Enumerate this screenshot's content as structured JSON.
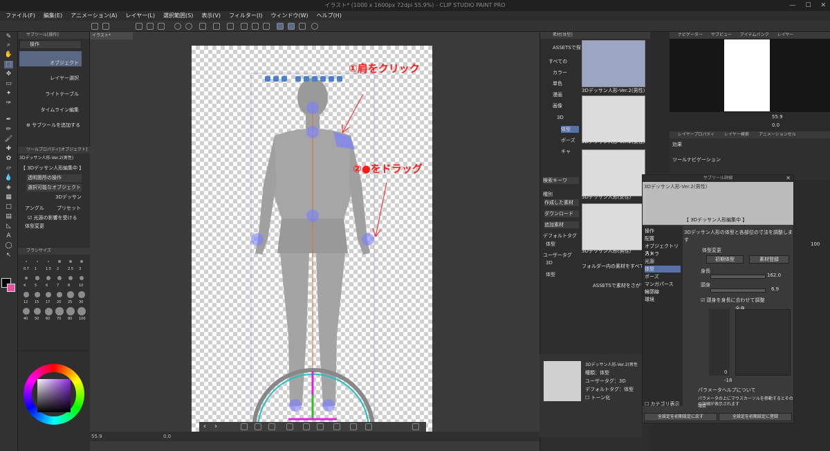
{
  "titlebar": {
    "title": "イラスト* (1000 x 1600px 72dpi 55.9%) - CLIP STUDIO PAINT PRO",
    "controls": [
      "—",
      "☐",
      "✕"
    ]
  },
  "menu": [
    "ファイル(F)",
    "編集(E)",
    "アニメーション(A)",
    "レイヤー(L)",
    "選択範囲(S)",
    "表示(V)",
    "フィルター(I)",
    "ウィンドウ(W)",
    "ヘルプ(H)"
  ],
  "subtool": {
    "header": "サブツール[操作]",
    "tab": "操作",
    "items": [
      "オブジェクト",
      "レイヤー選択",
      "ライトテーブル",
      "タイムライン編集"
    ],
    "add_label": "サブツールを追加する"
  },
  "toolprop": {
    "header": "ツールプロパティ[オブジェクト]",
    "top": "3Dデッサン人形-Ver.2(男性)",
    "mode": "【 3Dデッサン人形編集中 】",
    "rows": [
      "透明箇所の操作",
      "選択可能なオブジェクト",
      "3Dデッサン",
      "アングル",
      "プリセット",
      "光源の影響を受ける",
      "体型変更"
    ]
  },
  "brush": {
    "header": "ブラシサイズ",
    "sizes": [
      "0.7",
      "1",
      "1.5",
      "2",
      "2.5",
      "3",
      "4",
      "5",
      "6",
      "7",
      "8",
      "10",
      "12",
      "15",
      "17",
      "20",
      "25",
      "30",
      "40",
      "50",
      "60",
      "70",
      "80",
      "100"
    ]
  },
  "doc": {
    "tab": "イラスト*",
    "zoom": "55.9",
    "angle": "0.0"
  },
  "annotations": {
    "step1": "①肩をクリック",
    "step2": "②●をドラッグ"
  },
  "materials": {
    "header": "素材[体型]",
    "assets": "ASSETSで探す",
    "tree": [
      "すべての",
      "カラー",
      "単色",
      "漫画",
      "画像",
      "3D",
      "体型",
      "ポーズ",
      "キャ"
    ],
    "items": [
      {
        "caption": "3Dデッサン人形-Ver.2(男性)",
        "selected": true
      },
      {
        "caption": "3Dデッサン人形-Ver.2(女性)",
        "selected": false
      },
      {
        "caption": "3Dデッサン人形(女性)",
        "selected": false
      },
      {
        "caption": "3Dデッサン人形(男性)",
        "selected": false
      }
    ],
    "search_placeholder": "検索キーワ",
    "filters": {
      "kind_label": "種別",
      "kinds": [
        "作成した素材",
        "ダウンロード",
        "追加素材"
      ],
      "default_tag_label": "デフォルトタグ",
      "default_tag": "体型",
      "user_tag_label": "ユーザータグ",
      "user_tags": [
        "3D",
        "体型"
      ]
    },
    "folder_note": "フォルダー内の素材をすべて表示",
    "assets_link": "ASSETSで素材をさがす"
  },
  "matinfo": {
    "name": "3Dデッサン人形-Ver.2(男性",
    "type": "種類：体型",
    "user_tag": "ユーザータグ：3D",
    "default_tag": "デフォルトタグ：体型",
    "tone": "トーン化"
  },
  "navigator": {
    "tabs": [
      "ナビゲーター",
      "サブビュー",
      "アイテムバンク",
      "レイヤー"
    ],
    "zoom": "55.9",
    "angle": "0.0"
  },
  "layerprop": {
    "tabs": [
      "レイヤープロパティ",
      "レイヤー検索",
      "アニメーションセル"
    ],
    "effect_label": "効果",
    "nav_label": "ツールナビゲーション"
  },
  "dialog": {
    "title": "サブツール詳細",
    "preview_title": "3Dデッサン人形-Ver.2(男性)",
    "mode": "【 3Dデッサン人形編集中 】",
    "categories": [
      "操作",
      "配置",
      "オブジェクトリスト",
      "カメラ",
      "光源",
      "体型",
      "ポーズ",
      "マンガパース",
      "輪郭線",
      "環境"
    ],
    "selected_category": "体型",
    "description": "3Dデッサン人形の体型と各部位の寸法を調整します",
    "section": "体型変更",
    "buttons": {
      "init": "初期体型",
      "register": "素材登録"
    },
    "height_label": "身長",
    "height_value": "162.0",
    "heads_label": "頭身",
    "heads_value": "6.9",
    "check_label": "頭身を身長に合わせて調整",
    "whole_label": "全身",
    "val_a": "0",
    "val_b": "-18",
    "help_title": "パラメータヘルプについて",
    "help_text": "パラメータの上にマウスカーソルを移動するとその項目",
    "help_text2": "の詳細が表示されます",
    "show_label": "カテゴリ表示",
    "reset_all": "全設定を初期設定に戻す",
    "register_all": "全設定を初期設定に登録"
  },
  "right_extra": {
    "opacity": "100"
  }
}
